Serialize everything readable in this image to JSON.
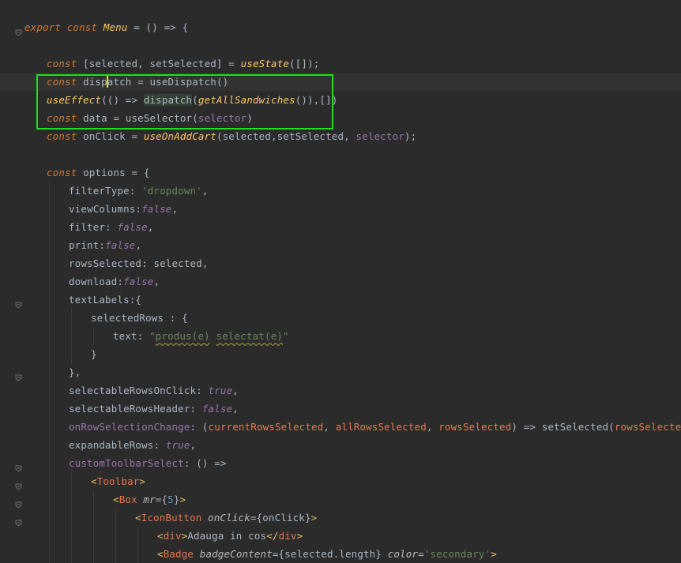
{
  "editor": {
    "language": "jsx",
    "current_line_index": 4,
    "highlight_box_color": "#22dd22",
    "lines": [
      {
        "indent": 0,
        "fold": false,
        "tokens": []
      },
      {
        "indent": 0,
        "fold": true,
        "tokens": [
          {
            "t": "export",
            "c": "kw"
          },
          {
            "t": " "
          },
          {
            "t": "const",
            "c": "kw"
          },
          {
            "t": " "
          },
          {
            "t": "Menu",
            "c": "fn"
          },
          {
            "t": " = () => {"
          }
        ]
      },
      {
        "indent": 0,
        "fold": false,
        "tokens": []
      },
      {
        "indent": 1,
        "fold": false,
        "tokens": [
          {
            "t": "const",
            "c": "kw"
          },
          {
            "t": " [selected, setSelected] = "
          },
          {
            "t": "useState",
            "c": "fn"
          },
          {
            "t": "([]);"
          }
        ]
      },
      {
        "indent": 1,
        "fold": false,
        "caret_after": 3,
        "tokens": [
          {
            "t": "const",
            "c": "kw"
          },
          {
            "t": " disp"
          },
          {
            "t": "atch = useDispatch()"
          }
        ]
      },
      {
        "indent": 1,
        "fold": false,
        "tokens": [
          {
            "t": "useEffect",
            "c": "fn"
          },
          {
            "t": "(() => "
          },
          {
            "t": "dispatch",
            "c": "hl"
          },
          {
            "t": "("
          },
          {
            "t": "getAllSandwiches",
            "c": "fn"
          },
          {
            "t": "()),[])"
          }
        ]
      },
      {
        "indent": 1,
        "fold": false,
        "tokens": [
          {
            "t": "const",
            "c": "kw"
          },
          {
            "t": " data = useSelector("
          },
          {
            "t": "selector",
            "c": "sel"
          },
          {
            "t": ")"
          }
        ]
      },
      {
        "indent": 1,
        "fold": false,
        "tokens": [
          {
            "t": "const",
            "c": "kw"
          },
          {
            "t": " onClick = "
          },
          {
            "t": "useOnAddCart",
            "c": "fn"
          },
          {
            "t": "(selected,setSelected, "
          },
          {
            "t": "selector",
            "c": "sel"
          },
          {
            "t": ");"
          }
        ]
      },
      {
        "indent": 0,
        "fold": false,
        "tokens": []
      },
      {
        "indent": 1,
        "fold": false,
        "tokens": [
          {
            "t": "const",
            "c": "kw"
          },
          {
            "t": " options = {"
          }
        ]
      },
      {
        "indent": 2,
        "fold": false,
        "tokens": [
          {
            "t": "filterType: "
          },
          {
            "t": "'dropdown'",
            "c": "str"
          },
          {
            "t": ","
          }
        ]
      },
      {
        "indent": 2,
        "fold": false,
        "tokens": [
          {
            "t": "viewColumns:"
          },
          {
            "t": "false",
            "c": "bool"
          },
          {
            "t": ","
          }
        ]
      },
      {
        "indent": 2,
        "fold": false,
        "tokens": [
          {
            "t": "filter: "
          },
          {
            "t": "false",
            "c": "bool"
          },
          {
            "t": ","
          }
        ]
      },
      {
        "indent": 2,
        "fold": false,
        "tokens": [
          {
            "t": "print:"
          },
          {
            "t": "false",
            "c": "bool"
          },
          {
            "t": ","
          }
        ]
      },
      {
        "indent": 2,
        "fold": false,
        "tokens": [
          {
            "t": "rowsSelected: selected,"
          }
        ]
      },
      {
        "indent": 2,
        "fold": false,
        "tokens": [
          {
            "t": "download:"
          },
          {
            "t": "false",
            "c": "bool"
          },
          {
            "t": ","
          }
        ]
      },
      {
        "indent": 2,
        "fold": true,
        "tokens": [
          {
            "t": "textLabels:{"
          }
        ]
      },
      {
        "indent": 3,
        "fold": false,
        "tokens": [
          {
            "t": "selectedRows : {"
          }
        ]
      },
      {
        "indent": 4,
        "fold": false,
        "tokens": [
          {
            "t": "text: "
          },
          {
            "t": "\"",
            "c": "str"
          },
          {
            "t": "produs(e)",
            "c": "strtypo"
          },
          {
            "t": " ",
            "c": "str"
          },
          {
            "t": "selectat(e)",
            "c": "strtypo"
          },
          {
            "t": "\"",
            "c": "str"
          }
        ]
      },
      {
        "indent": 3,
        "fold": false,
        "tokens": [
          {
            "t": "}"
          }
        ]
      },
      {
        "indent": 2,
        "fold": true,
        "tokens": [
          {
            "t": "},"
          }
        ]
      },
      {
        "indent": 2,
        "fold": false,
        "tokens": [
          {
            "t": "selectableRowsOnClick: "
          },
          {
            "t": "true",
            "c": "bool"
          },
          {
            "t": ","
          }
        ]
      },
      {
        "indent": 2,
        "fold": false,
        "tokens": [
          {
            "t": "selectableRowsHeader: "
          },
          {
            "t": "false",
            "c": "bool"
          },
          {
            "t": ","
          }
        ]
      },
      {
        "indent": 2,
        "fold": false,
        "tokens": [
          {
            "t": "onRowSelectionChange",
            "c": "method"
          },
          {
            "t": ": ("
          },
          {
            "t": "currentRowsSelected",
            "c": "param"
          },
          {
            "t": ", "
          },
          {
            "t": "allRowsSelected",
            "c": "param"
          },
          {
            "t": ", "
          },
          {
            "t": "rowsSelected",
            "c": "param"
          },
          {
            "t": ") => setSelected("
          },
          {
            "t": "rowsSelected",
            "c": "param"
          },
          {
            "t": "),"
          }
        ]
      },
      {
        "indent": 2,
        "fold": false,
        "tokens": [
          {
            "t": "expandableRows: "
          },
          {
            "t": "true",
            "c": "bool"
          },
          {
            "t": ","
          }
        ]
      },
      {
        "indent": 2,
        "fold": true,
        "tokens": [
          {
            "t": "customToolbarSelect",
            "c": "method"
          },
          {
            "t": ": () =>"
          }
        ]
      },
      {
        "indent": 3,
        "fold": true,
        "tokens": [
          {
            "t": "<",
            "c": "tag"
          },
          {
            "t": "Toolbar",
            "c": "tagname"
          },
          {
            "t": ">",
            "c": "tag"
          }
        ]
      },
      {
        "indent": 4,
        "fold": true,
        "tokens": [
          {
            "t": "<",
            "c": "tag"
          },
          {
            "t": "Box",
            "c": "tagname"
          },
          {
            "t": " "
          },
          {
            "t": "mr",
            "c": "attr"
          },
          {
            "t": "={"
          },
          {
            "t": "5",
            "c": "num"
          },
          {
            "t": "}"
          },
          {
            "t": ">",
            "c": "tag"
          }
        ]
      },
      {
        "indent": 5,
        "fold": true,
        "tokens": [
          {
            "t": "<",
            "c": "tag"
          },
          {
            "t": "IconButton",
            "c": "tagname"
          },
          {
            "t": " "
          },
          {
            "t": "onClick",
            "c": "attr"
          },
          {
            "t": "={onClick}"
          },
          {
            "t": ">",
            "c": "tag"
          }
        ]
      },
      {
        "indent": 6,
        "fold": false,
        "tokens": [
          {
            "t": "<",
            "c": "tag"
          },
          {
            "t": "div",
            "c": "tagname"
          },
          {
            "t": ">",
            "c": "tag"
          },
          {
            "t": "Adauga in cos"
          },
          {
            "t": "</",
            "c": "tag"
          },
          {
            "t": "div",
            "c": "tagname"
          },
          {
            "t": ">",
            "c": "tag"
          }
        ]
      },
      {
        "indent": 6,
        "fold": false,
        "tokens": [
          {
            "t": "<",
            "c": "tag"
          },
          {
            "t": "Badge",
            "c": "tagname"
          },
          {
            "t": " "
          },
          {
            "t": "badgeContent",
            "c": "attr"
          },
          {
            "t": "={selected.length} "
          },
          {
            "t": "color",
            "c": "attr"
          },
          {
            "t": "="
          },
          {
            "t": "'secondary'",
            "c": "str"
          },
          {
            "t": ">",
            "c": "tag"
          }
        ]
      }
    ]
  }
}
